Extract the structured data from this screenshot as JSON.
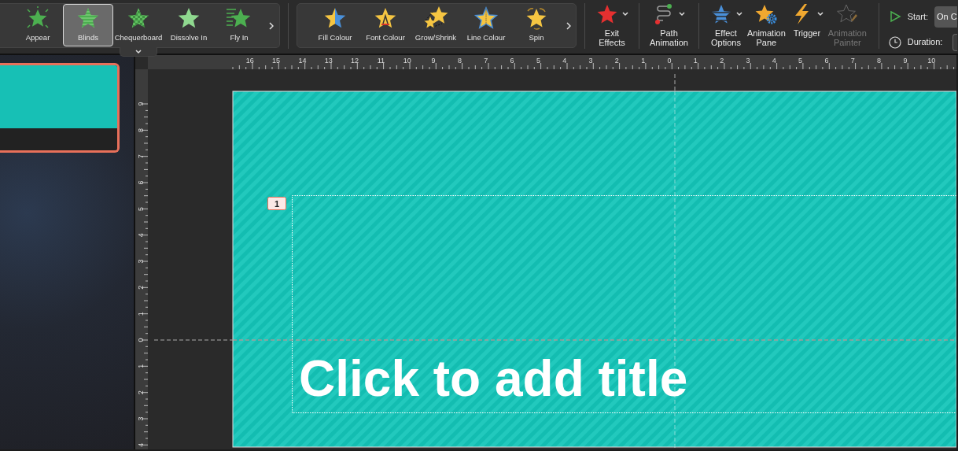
{
  "ribbon": {
    "entrance_gallery": [
      {
        "label": "Appear",
        "selected": false
      },
      {
        "label": "Blinds",
        "selected": true
      },
      {
        "label": "Chequerboard",
        "selected": false
      },
      {
        "label": "Dissolve In",
        "selected": false
      },
      {
        "label": "Fly In",
        "selected": false
      }
    ],
    "emphasis_gallery": [
      {
        "label": "Fill Colour",
        "selected": false
      },
      {
        "label": "Font Colour",
        "selected": false
      },
      {
        "label": "Grow/Shrink",
        "selected": false
      },
      {
        "label": "Line Colour",
        "selected": false
      },
      {
        "label": "Spin",
        "selected": false
      }
    ],
    "commands": [
      {
        "label": "Exit Effects",
        "menu": true,
        "disabled": false
      },
      {
        "label": "Path Animation",
        "menu": true,
        "disabled": false
      },
      {
        "label": "Effect Options",
        "menu": true,
        "disabled": false
      },
      {
        "label": "Animation Pane",
        "menu": false,
        "disabled": false
      },
      {
        "label": "Trigger",
        "menu": true,
        "disabled": false
      },
      {
        "label": "Animation Painter",
        "menu": false,
        "disabled": true
      }
    ],
    "timing": {
      "start_label": "Start:",
      "start_value": "On C",
      "duration_label": "Duration:"
    }
  },
  "thumbnails": [
    {
      "selected": true
    }
  ],
  "rulers": {
    "horizontal": [
      "16",
      "15",
      "14",
      "13",
      "12",
      "11",
      "10",
      "9",
      "8",
      "7",
      "6",
      "5",
      "4",
      "3",
      "2",
      "1",
      "0",
      "1",
      "2",
      "3",
      "4",
      "5",
      "6",
      "7",
      "8",
      "9",
      "10"
    ],
    "vertical": [
      "9",
      "8",
      "7",
      "6",
      "5",
      "4",
      "3",
      "2",
      "1",
      "0",
      "1",
      "2",
      "3",
      "4"
    ]
  },
  "slide": {
    "animation_tag": "1",
    "title_placeholder": "Click to add title"
  }
}
